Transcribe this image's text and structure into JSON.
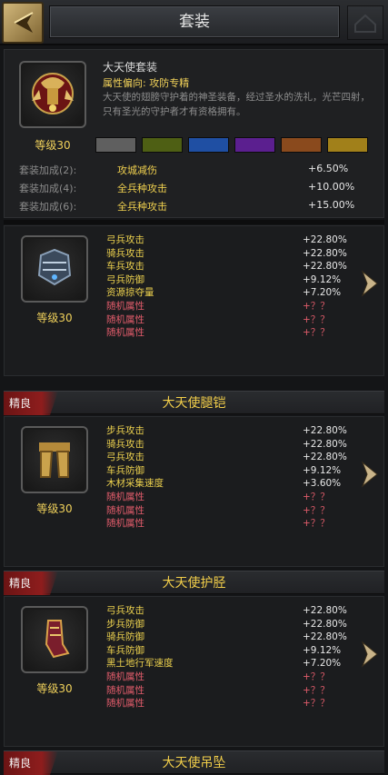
{
  "header": {
    "title": "套装"
  },
  "set": {
    "name": "大天使套装",
    "attr_tendency": "属性偏向: 攻防专精",
    "description": "大天使的翅膀守护着的神圣装备，经过圣水的洗礼，光芒四射，只有圣光的守护者才有资格拥有。",
    "level": "等级30",
    "swatches": [
      "#5f5f5f",
      "#4e5f14",
      "#1f4fa3",
      "#5b1f8f",
      "#8a4a1d",
      "#a1801a"
    ],
    "bonuses": [
      {
        "label": "套装加成(2):",
        "stat": "攻城减伤",
        "value": "+6.50%"
      },
      {
        "label": "套装加成(4):",
        "stat": "全兵种攻击",
        "value": "+10.00%"
      },
      {
        "label": "套装加成(6):",
        "stat": "全兵种攻击",
        "value": "+15.00%"
      }
    ]
  },
  "items": [
    {
      "quality": "",
      "name": "",
      "level": "等级30",
      "icon": "armor-icon",
      "stats": [
        {
          "name": "弓兵攻击",
          "value": "+22.80%",
          "random": false
        },
        {
          "name": "骑兵攻击",
          "value": "+22.80%",
          "random": false
        },
        {
          "name": "车兵攻击",
          "value": "+22.80%",
          "random": false
        },
        {
          "name": "弓兵防御",
          "value": "+9.12%",
          "random": false
        },
        {
          "name": "资源掠夺量",
          "value": "+7.20%",
          "random": false
        },
        {
          "name": "随机属性",
          "value": "+？？",
          "random": true
        },
        {
          "name": "随机属性",
          "value": "+？？",
          "random": true
        },
        {
          "name": "随机属性",
          "value": "+？？",
          "random": true
        }
      ]
    },
    {
      "quality": "精良",
      "name": "大天使腿铠",
      "level": "等级30",
      "icon": "leg-armor-icon",
      "stats": [
        {
          "name": "步兵攻击",
          "value": "+22.80%",
          "random": false
        },
        {
          "name": "骑兵攻击",
          "value": "+22.80%",
          "random": false
        },
        {
          "name": "弓兵攻击",
          "value": "+22.80%",
          "random": false
        },
        {
          "name": "车兵防御",
          "value": "+9.12%",
          "random": false
        },
        {
          "name": "木材采集速度",
          "value": "+3.60%",
          "random": false
        },
        {
          "name": "随机属性",
          "value": "+？？",
          "random": true
        },
        {
          "name": "随机属性",
          "value": "+？？",
          "random": true
        },
        {
          "name": "随机属性",
          "value": "+？？",
          "random": true
        }
      ]
    },
    {
      "quality": "精良",
      "name": "大天使护胫",
      "level": "等级30",
      "icon": "greaves-icon",
      "stats": [
        {
          "name": "弓兵攻击",
          "value": "+22.80%",
          "random": false
        },
        {
          "name": "步兵防御",
          "value": "+22.80%",
          "random": false
        },
        {
          "name": "骑兵防御",
          "value": "+22.80%",
          "random": false
        },
        {
          "name": "车兵防御",
          "value": "+9.12%",
          "random": false
        },
        {
          "name": "黑土地行军速度",
          "value": "+7.20%",
          "random": false
        },
        {
          "name": "随机属性",
          "value": "+？？",
          "random": true
        },
        {
          "name": "随机属性",
          "value": "+？？",
          "random": true
        },
        {
          "name": "随机属性",
          "value": "+？？",
          "random": true
        }
      ]
    },
    {
      "quality": "精良",
      "name": "大天使吊坠",
      "level": "",
      "icon": "pendant-icon",
      "stats": []
    }
  ]
}
